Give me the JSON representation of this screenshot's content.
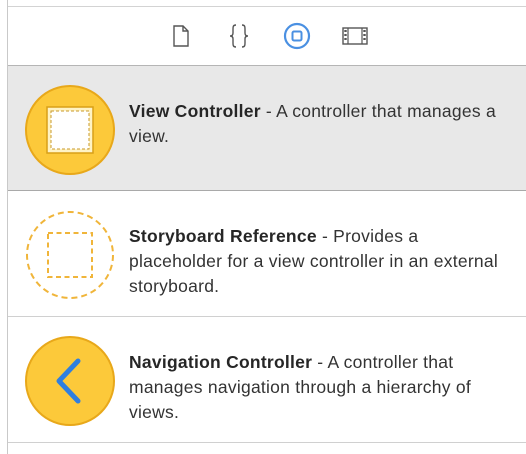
{
  "library_tabs": [
    {
      "name": "file-template-tab",
      "icon": "file-icon",
      "selected": false
    },
    {
      "name": "code-snippet-tab",
      "icon": "braces-icon",
      "selected": false
    },
    {
      "name": "object-library-tab",
      "icon": "object-library-icon",
      "selected": true
    },
    {
      "name": "media-library-tab",
      "icon": "film-strip-icon",
      "selected": false
    }
  ],
  "items": [
    {
      "title": "View Controller",
      "separator": " - ",
      "description": "A controller that manages a view.",
      "icon": "view-controller-icon",
      "selected": true
    },
    {
      "title": "Storyboard Reference",
      "separator": " - ",
      "description": "Provides a placeholder for a view controller in an external storyboard.",
      "icon": "storyboard-reference-icon",
      "selected": false
    },
    {
      "title": "Navigation Controller",
      "separator": " - ",
      "description": "A controller that manages navigation through a hierarchy of views.",
      "icon": "navigation-controller-icon",
      "selected": false
    }
  ],
  "colors": {
    "accent_blue": "#4a90e2",
    "icon_yellow": "#fcc93a",
    "icon_yellow_border": "#e8a81a",
    "selection_gray": "#e8e8e8"
  }
}
